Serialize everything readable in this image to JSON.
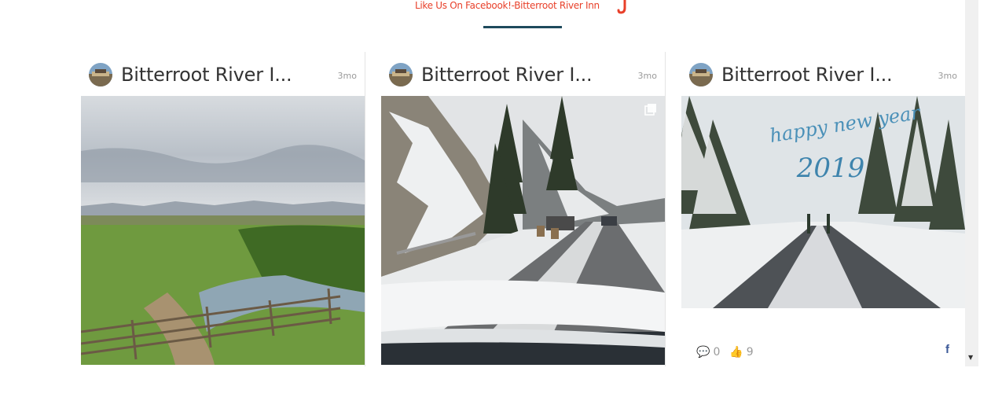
{
  "header": {
    "title": "Like Us On Facebook!-Bitterroot River Inn",
    "accent_color": "#e8402a",
    "underline_color": "#1e4a5c"
  },
  "posts": [
    {
      "author": "Bitterroot River I...",
      "time": "3mo",
      "image": "meadow-creek-fence-mountains"
    },
    {
      "author": "Bitterroot River I...",
      "time": "3mo",
      "image": "snowy-road-bighorn-sheep",
      "icon": "multiple-photos-icon"
    },
    {
      "author": "Bitterroot River I...",
      "time": "3mo",
      "image": "snowy-road-happy-new-year",
      "overlay_line1": "happy new year",
      "overlay_line2": "2019",
      "comments": "0",
      "likes": "9",
      "share_icon": "facebook-icon",
      "share_glyph": "f"
    }
  ]
}
